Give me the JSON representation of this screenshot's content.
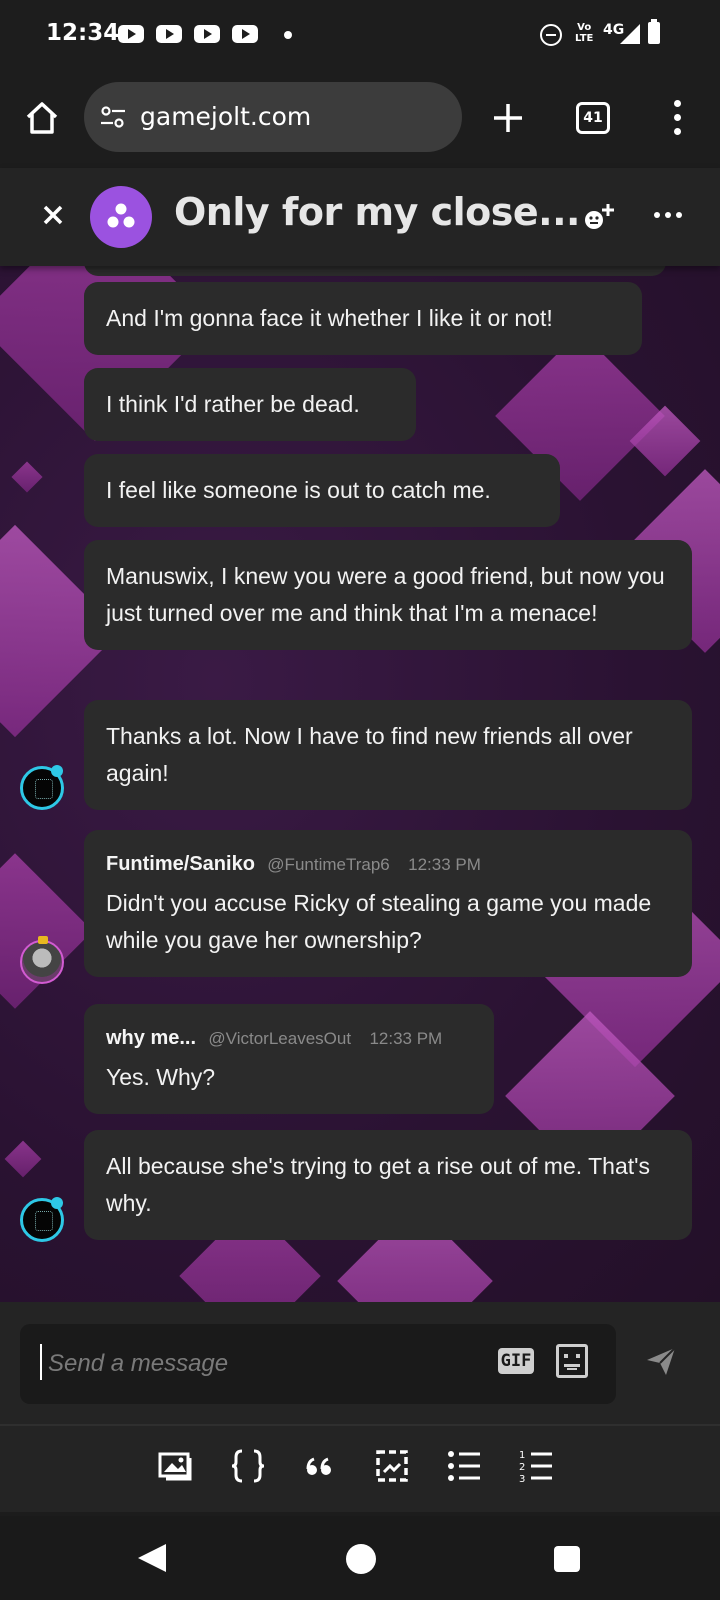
{
  "status_bar": {
    "time": "12:34",
    "network": "4G",
    "volte_top": "Vo",
    "volte_bottom": "LTE",
    "icons": [
      "youtube-icon",
      "youtube-icon",
      "youtube-icon",
      "youtube-icon",
      "notification-dot",
      "do-not-disturb-icon",
      "volte-icon",
      "signal-icon",
      "battery-icon"
    ]
  },
  "browser": {
    "url": "gamejolt.com",
    "tab_count": "41",
    "icons": [
      "home-icon",
      "site-settings-icon",
      "new-tab-icon",
      "tabs-icon",
      "overflow-menu-icon"
    ]
  },
  "chat_header": {
    "title": "Only for my close...",
    "icons": [
      "close-icon",
      "group-icon",
      "add-member-icon",
      "more-icon"
    ]
  },
  "messages": [
    {
      "text": "And I'm gonna face it whether I like it or not!"
    },
    {
      "text": "I think I'd rather be dead."
    },
    {
      "text": "I feel like someone is out to catch me."
    },
    {
      "text": "Manuswix, I knew you were a good friend, but now you just turned over me and think that I'm a menace!"
    },
    {
      "text": "Thanks a lot. Now I have to find new friends all over again!"
    },
    {
      "sender": "Funtime/Saniko",
      "handle": "@FuntimeTrap6",
      "time": "12:33 PM",
      "text": "Didn't you accuse Ricky of stealing a game you made while you gave her ownership?"
    },
    {
      "sender": "why me...",
      "handle": "@VictorLeavesOut",
      "time": "12:33 PM",
      "text": "Yes. Why?"
    },
    {
      "text": "All because she's trying to get a rise out of me. That's why."
    }
  ],
  "composer": {
    "placeholder": "Send a message",
    "gif_label": "GIF",
    "icons": [
      "sticker-icon",
      "send-icon"
    ]
  },
  "toolbar": {
    "icons": [
      "image-icon",
      "code-block-icon",
      "quote-icon",
      "spoiler-icon",
      "bullet-list-icon",
      "numbered-list-icon"
    ]
  },
  "nav": {
    "icons": [
      "back-icon",
      "home-icon",
      "recents-icon"
    ]
  }
}
